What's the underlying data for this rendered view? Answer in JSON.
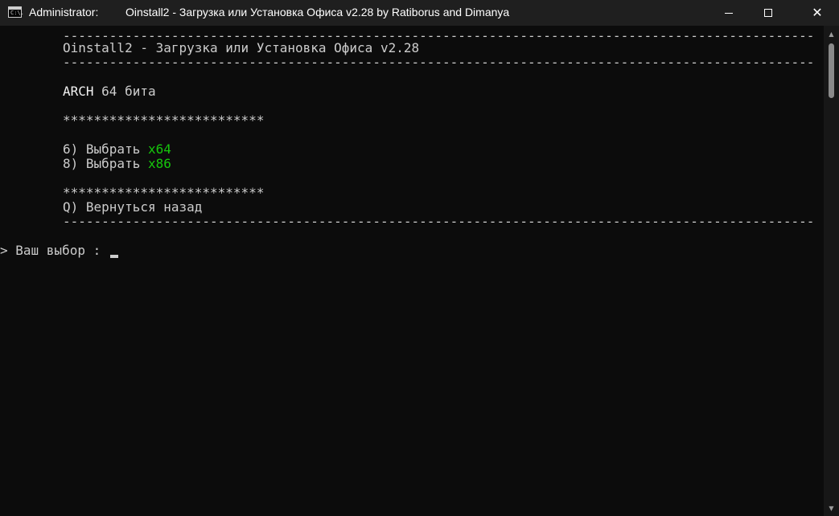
{
  "window": {
    "admin_label": "Administrator:",
    "title": "Oinstall2 - Загрузка или Установка Офиса v2.28 by Ratiborus and Dimanya",
    "icon": "cmd-icon",
    "icon_text": "C:\\."
  },
  "console": {
    "dash_line": "--------------------------------------------------------------------------------------------------------------------------------------------------------",
    "header": "Oinstall2 - Загрузка или Установка Офиса v2.28",
    "arch_label": "ARCH",
    "arch_value": " 64 бита",
    "stars": "**************************",
    "menu": [
      {
        "key": "6) Выбрать ",
        "value": "x64"
      },
      {
        "key": "8) Выбрать ",
        "value": "x86"
      }
    ],
    "back": "Q) Вернуться назад",
    "prompt": "> Ваш выбор : "
  },
  "colors": {
    "background": "#0c0c0c",
    "text": "#cccccc",
    "accent_green": "#16c60c",
    "titlebar": "#1f1f1f"
  }
}
